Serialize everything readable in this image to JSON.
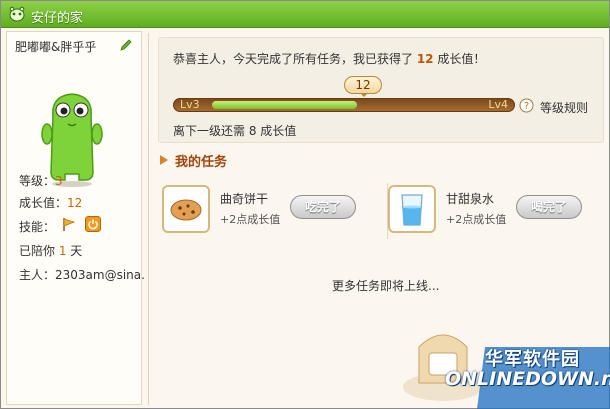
{
  "window": {
    "title": "安仔的家"
  },
  "pet": {
    "name": "肥嘟嘟&胖乎乎",
    "level_label": "等级：",
    "level_value": "3",
    "growth_label": "成长值：",
    "growth_value": "12",
    "skills_label": "技能：",
    "days_prefix": "已陪你 ",
    "days_value": "1",
    "days_suffix": " 天",
    "owner_label": "主人：",
    "owner_value": "2303am@sina."
  },
  "progress": {
    "message_prefix": "恭喜主人，今天完成了所有任务，我已获得了 ",
    "message_value": "12",
    "message_suffix": " 成长值！",
    "current_value": "12",
    "current_level": "Lv3",
    "next_level": "Lv4",
    "fill_fraction": 0.55,
    "rules_link": "等级规则",
    "remaining_text": "离下一级还需 8 成长值"
  },
  "tasks": {
    "header": "我的任务",
    "items": [
      {
        "title": "曲奇饼干",
        "reward": "+2点成长值",
        "button": "吃完了",
        "icon": "cookie-icon"
      },
      {
        "title": "甘甜泉水",
        "reward": "+2点成长值",
        "button": "喝完了",
        "icon": "water-glass-icon"
      }
    ],
    "more": "更多任务即将上线..."
  },
  "watermark": {
    "cn": "华军软件园",
    "en": "ONLINEDOWN.net"
  },
  "colors": {
    "titlebar": "#6fbd2a",
    "accent": "#c25400",
    "progress_fill": "#8fd03a"
  }
}
